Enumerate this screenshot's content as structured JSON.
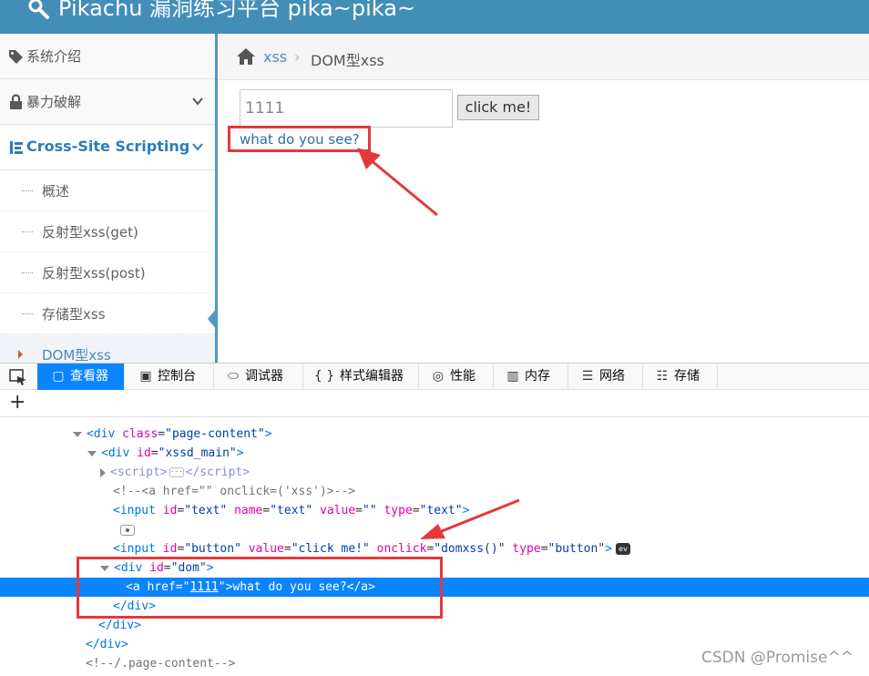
{
  "header": {
    "title": "Pikachu 漏洞练习平台 pika~pika~"
  },
  "sidebar": {
    "items": [
      {
        "label": "系统介绍",
        "icon": "tags-icon"
      },
      {
        "label": "暴力破解",
        "icon": "lock-icon"
      },
      {
        "label": "Cross-Site Scripting",
        "icon": "sitemap-icon"
      }
    ],
    "subitems": [
      "概述",
      "反射型xss(get)",
      "反射型xss(post)",
      "存储型xss",
      "DOM型xss"
    ]
  },
  "breadcrumb": {
    "link": "xss",
    "separator": "›",
    "current": "DOM型xss"
  },
  "form": {
    "input_value": "1111",
    "button_label": "click me!",
    "result_link": "what do you see?"
  },
  "devtools": {
    "tabs": [
      {
        "label": "查看器",
        "icon": "▢"
      },
      {
        "label": "控制台",
        "icon": "▣"
      },
      {
        "label": "调试器",
        "icon": "⬭"
      },
      {
        "label": "样式编辑器",
        "icon": "{ }"
      },
      {
        "label": "性能",
        "icon": "◎"
      },
      {
        "label": "内存",
        "icon": "▥"
      },
      {
        "label": "网络",
        "icon": "☰"
      },
      {
        "label": "存储",
        "icon": "☷"
      }
    ],
    "add_label": "+",
    "tree": {
      "page_content_tag": "div",
      "page_content_class": "page-content",
      "main_id": "xssd_main",
      "script_tag": "script",
      "comment": "<!--<a href=\"\" onclick=('xss')>-->",
      "input1_id": "text",
      "input1_name": "text",
      "input1_value": "",
      "input1_type": "text",
      "input2_id": "button",
      "input2_value": "click me!",
      "input2_onclick": "domxss()",
      "input2_type": "button",
      "ev_badge": "ev",
      "dom_id": "dom",
      "link_href": "1111",
      "link_text": "what do you see?",
      "end_comment": "<!--/.page-content-->"
    }
  },
  "watermark": "CSDN @Promise^^",
  "colors": {
    "header_bg": "#438eb9",
    "highlight_red": "#e4393c",
    "devtools_selected": "#0a84ff"
  }
}
